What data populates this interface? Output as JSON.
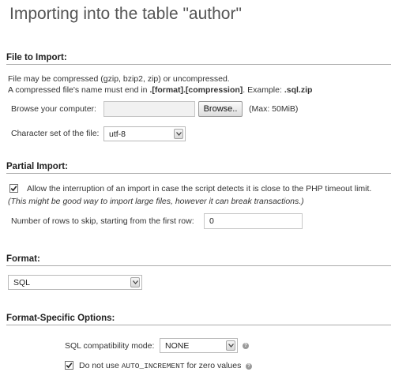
{
  "page": {
    "title": "Importing into the table \"author\""
  },
  "file_to_import": {
    "heading": "File to Import:",
    "note_line1": "File may be compressed (gzip, bzip2, zip) or uncompressed.",
    "note_line2_prefix": "A compressed file's name must end in ",
    "note_line2_format": ".[format].[compression]",
    "note_line2_example_label": ". Example: ",
    "note_line2_example": ".sql.zip",
    "browse_label": "Browse your computer:",
    "browse_button": "Browse..",
    "max_size": "(Max: 50MiB)",
    "charset_label": "Character set of the file:",
    "charset_value": "utf-8"
  },
  "partial_import": {
    "heading": "Partial Import:",
    "allow_interrupt_label": "Allow the interruption of an import in case the script detects it is close to the PHP timeout limit.",
    "allow_interrupt_checked": true,
    "hint": "(This might be good way to import large files, however it can break transactions.)",
    "skip_rows_label": "Number of rows to skip, starting from the first row:",
    "skip_rows_value": "0"
  },
  "format": {
    "heading": "Format:",
    "value": "SQL"
  },
  "format_specific": {
    "heading": "Format-Specific Options:",
    "compat_label": "SQL compatibility mode:",
    "compat_value": "NONE",
    "auto_inc_prefix": "Do not use ",
    "auto_inc_code": "AUTO_INCREMENT",
    "auto_inc_suffix": " for zero values",
    "auto_inc_checked": true
  },
  "icons": {
    "dropdown": "chevron-down-icon",
    "check": "checkmark-icon",
    "help": "help-icon"
  },
  "colors": {
    "rule": "#aaaaaa",
    "heading_text": "#222222",
    "title_text": "#555555"
  }
}
